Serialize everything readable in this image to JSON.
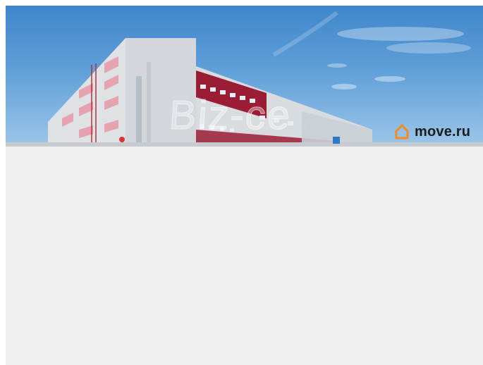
{
  "photo": {
    "watermark_text": "Biz-ce",
    "sky_color": "#4a8fd2",
    "wall_color": "#d9dcdf",
    "stripe_color": "#9b1c35"
  },
  "logo": {
    "icon": "house-icon",
    "text": "move.ru",
    "accent_color": "#f28c1b"
  },
  "content": {
    "background_color": "#efefef"
  }
}
